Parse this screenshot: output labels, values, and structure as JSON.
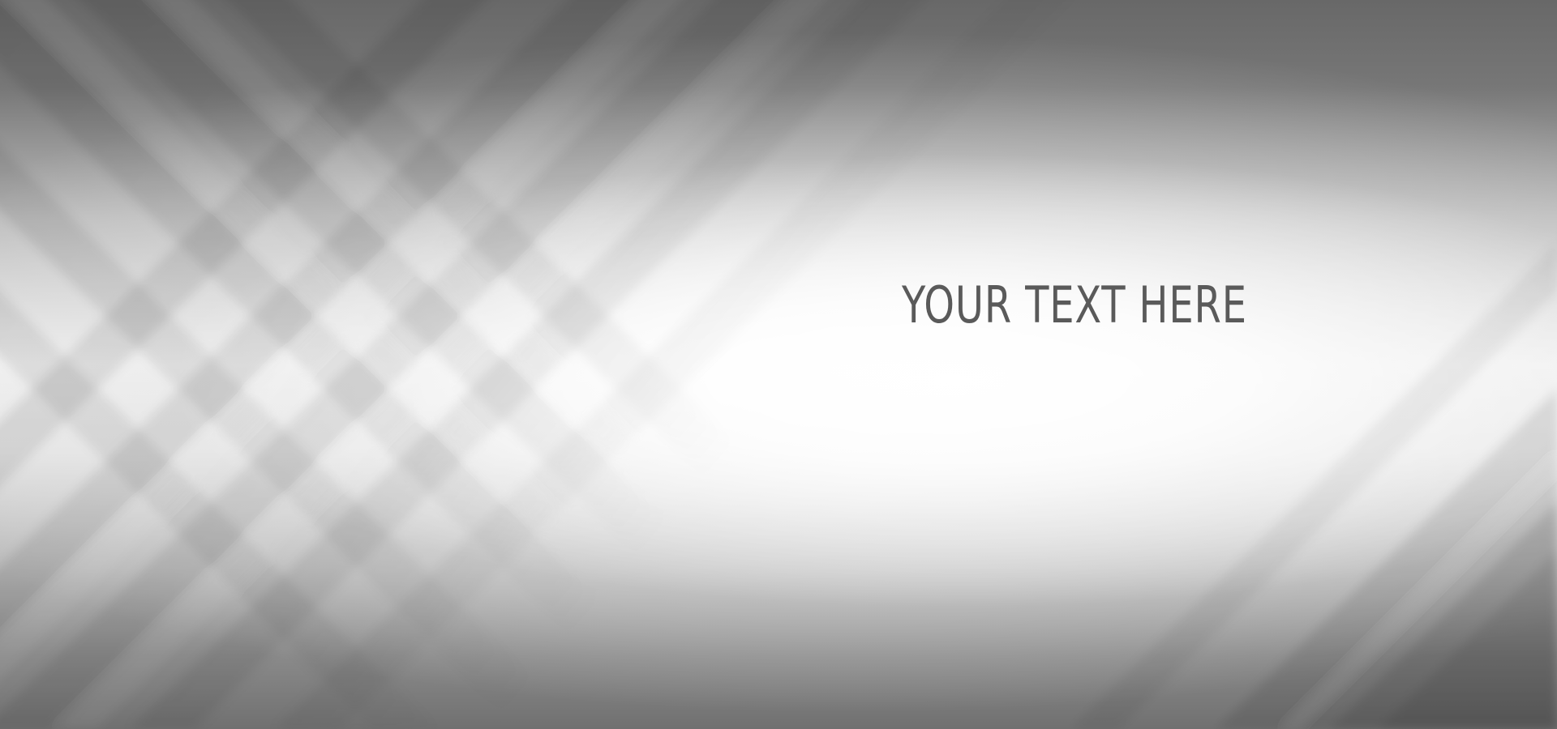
{
  "banner": {
    "headline": "YOUR TEXT HERE"
  },
  "colors": {
    "text": "#5a5a5a",
    "dark_gray": "#686868",
    "light_center": "#ffffff"
  }
}
